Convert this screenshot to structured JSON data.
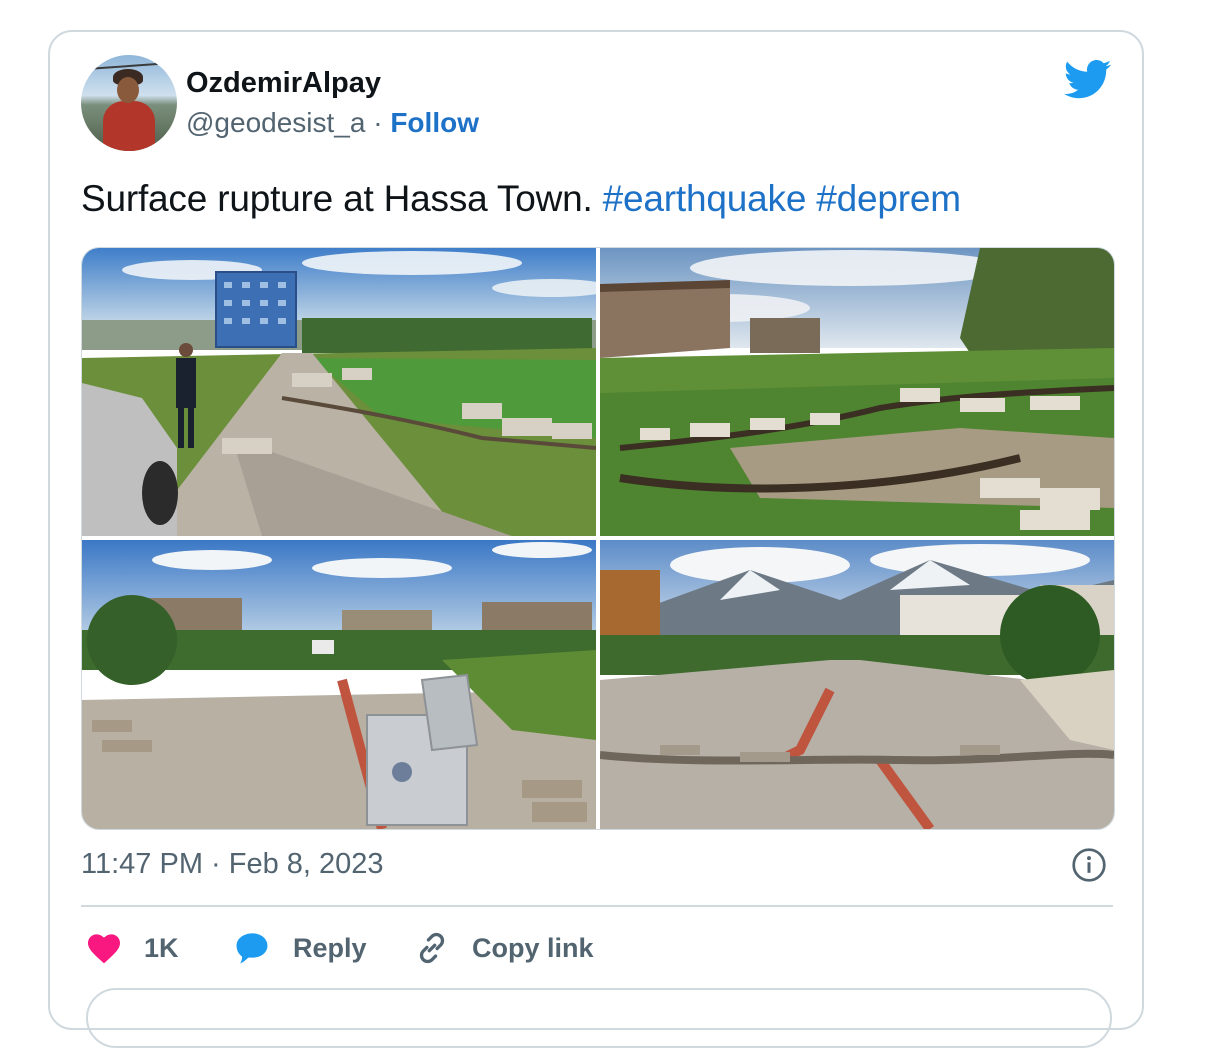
{
  "tweet": {
    "author_name": "OzdemirAlpay",
    "handle": "@geodesist_a",
    "separator": " · ",
    "follow_label": "Follow",
    "text_plain": "Surface rupture at Hassa Town. ",
    "hashtags": [
      "#earthquake",
      "#deprem"
    ],
    "timestamp": "11:47 PM · Feb 8, 2023",
    "media_count": 4
  },
  "actions": {
    "like_count": "1K",
    "reply_label": "Reply",
    "copy_link_label": "Copy link"
  },
  "icons": {
    "brand": "twitter-bird-icon",
    "like": "heart-icon",
    "reply": "speech-bubble-icon",
    "copy": "link-icon",
    "info": "info-icon"
  },
  "colors": {
    "accent": "#1d9bf0",
    "link": "#1d72c8",
    "like": "#f91880",
    "muted": "#536471",
    "border": "#cfd9de"
  }
}
